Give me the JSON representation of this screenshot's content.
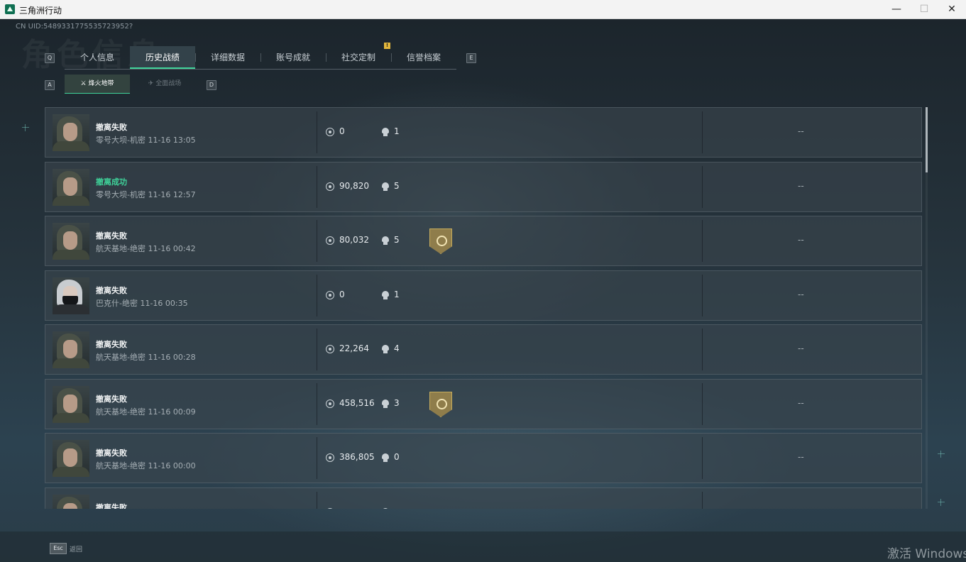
{
  "window": {
    "title": "三角洲行动",
    "minimize": "—",
    "maximize": "☐",
    "close": "✕"
  },
  "header": {
    "uid": "CN UID:5489331775535723952?",
    "ghost_title": "角色信息"
  },
  "tabs": {
    "prev_key": "Q",
    "next_key": "E",
    "badge": "!",
    "items": [
      {
        "label": "个人信息"
      },
      {
        "label": "历史战绩"
      },
      {
        "label": "详细数据"
      },
      {
        "label": "账号成就"
      },
      {
        "label": "社交定制"
      },
      {
        "label": "信誉档案"
      }
    ],
    "active_index": 1
  },
  "subtabs": {
    "prev_key": "A",
    "next_key": "D",
    "items": [
      {
        "label": "烽火地带",
        "active": true
      },
      {
        "label": "全面战场",
        "active": false
      }
    ]
  },
  "records": [
    {
      "status": "撤离失败",
      "map_time": "零号大坝-机密 11-16 13:05",
      "value": "0",
      "kills": "1",
      "medal": false,
      "extra": "--",
      "success": false,
      "avatar": "green"
    },
    {
      "status": "撤离成功",
      "map_time": "零号大坝-机密 11-16 12:57",
      "value": "90,820",
      "kills": "5",
      "medal": false,
      "extra": "--",
      "success": true,
      "avatar": "green"
    },
    {
      "status": "撤离失败",
      "map_time": "航天基地-绝密 11-16 00:42",
      "value": "80,032",
      "kills": "5",
      "medal": true,
      "extra": "--",
      "success": false,
      "avatar": "green"
    },
    {
      "status": "撤离失败",
      "map_time": "巴克什-绝密 11-16 00:35",
      "value": "0",
      "kills": "1",
      "medal": false,
      "extra": "--",
      "success": false,
      "avatar": "white"
    },
    {
      "status": "撤离失败",
      "map_time": "航天基地-绝密 11-16 00:28",
      "value": "22,264",
      "kills": "4",
      "medal": false,
      "extra": "--",
      "success": false,
      "avatar": "green"
    },
    {
      "status": "撤离失败",
      "map_time": "航天基地-绝密 11-16 00:09",
      "value": "458,516",
      "kills": "3",
      "medal": true,
      "extra": "--",
      "success": false,
      "avatar": "green"
    },
    {
      "status": "撤离失败",
      "map_time": "航天基地-绝密 11-16 00:00",
      "value": "386,805",
      "kills": "0",
      "medal": false,
      "extra": "--",
      "success": false,
      "avatar": "green"
    },
    {
      "status": "撤离失败",
      "map_time": "",
      "value": "",
      "kills": "",
      "medal": false,
      "extra": "",
      "success": false,
      "avatar": "green"
    }
  ],
  "footer": {
    "esc_key": "Esc",
    "back_label": "返回"
  },
  "watermark": "激活 Windows",
  "colors": {
    "accent": "#3fd39a",
    "badge": "#e2b63c",
    "medal": "#8f7d4b"
  }
}
